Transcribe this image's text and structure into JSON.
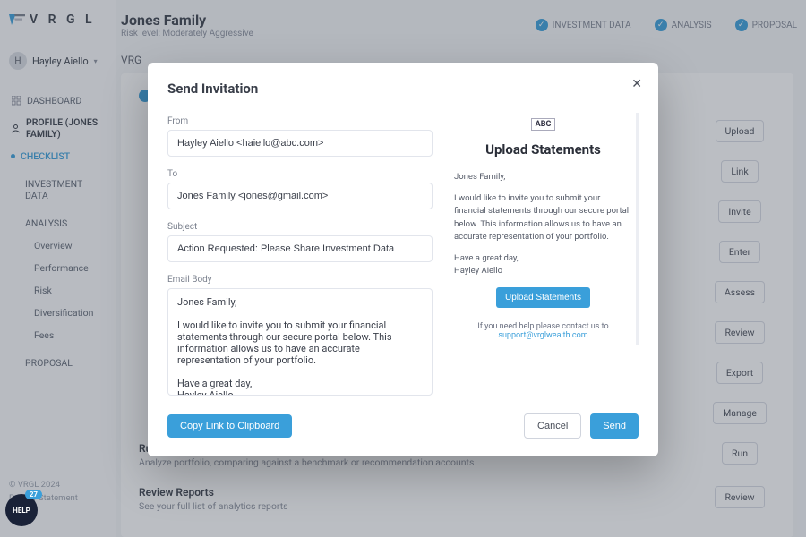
{
  "brand": "V R G L",
  "user": {
    "initial": "H",
    "name": "Hayley Aiello"
  },
  "sidebar": {
    "items": [
      {
        "label": "DASHBOARD",
        "icon": "grid"
      },
      {
        "label": "PROFILE (JONES FAMILY)",
        "icon": "person",
        "bold": true
      },
      {
        "label": "CHECKLIST",
        "active": true
      },
      {
        "label": "INVESTMENT DATA"
      },
      {
        "label": "ANALYSIS"
      }
    ],
    "analysis_children": [
      "Overview",
      "Performance",
      "Risk",
      "Diversification",
      "Fees"
    ],
    "items_tail": [
      {
        "label": "PROPOSAL"
      }
    ],
    "footer": {
      "copyright": "© VRGL 2024",
      "privacy": "Privacy Statement"
    }
  },
  "header": {
    "client": "Jones Family",
    "risk": "Risk level: Moderately Aggressive",
    "steps": [
      "INVESTMENT DATA",
      "ANALYSIS",
      "PROPOSAL"
    ]
  },
  "background": {
    "breadcrumb_stub": "VRG",
    "rows": [
      {
        "title_stub": "",
        "button": "Upload"
      },
      {
        "title_stub": "",
        "button": "Link"
      },
      {
        "title_stub": "",
        "button": "Invite"
      },
      {
        "title_stub": "",
        "button": "Enter"
      },
      {
        "title_stub": "",
        "button": "Assess"
      },
      {
        "title_stub": "",
        "button": "Review"
      },
      {
        "title_stub": "",
        "button": "Export"
      },
      {
        "title_stub": "",
        "button": "Manage"
      },
      {
        "title": "Run Analytics",
        "sub": "Analyze portfolio, comparing against a benchmark or recommendation accounts",
        "button": "Run"
      },
      {
        "title": "Review Reports",
        "sub": "See your full list of analytics reports",
        "button": "Review"
      }
    ]
  },
  "modal": {
    "title": "Send Invitation",
    "labels": {
      "from": "From",
      "to": "To",
      "subject": "Subject",
      "body": "Email Body"
    },
    "from": "Hayley Aiello <haiello@abc.com>",
    "to": "Jones Family <jones@gmail.com>",
    "subject": "Action Requested: Please Share Investment Data",
    "body": "Jones Family,\n\nI would like to invite you to submit your financial statements through our secure portal below. This information allows us to have an accurate representation of your portfolio.\n\nHave a great day,\nHayley Aiello",
    "preview": {
      "brand": "ABC",
      "headline": "Upload Statements",
      "greeting": "Jones Family,",
      "body": "I would like to invite you to submit your financial statements through our secure portal below. This information allows us to have an accurate representation of your portfolio.",
      "signoff": "Have a great day,\nHayley Aiello",
      "cta": "Upload Statements",
      "support_text": "If you need help please contact us to ",
      "support_email": "support@vrglwealth.com"
    },
    "buttons": {
      "copy": "Copy Link to Clipboard",
      "cancel": "Cancel",
      "send": "Send"
    }
  },
  "help": {
    "label": "HELP",
    "count": "27"
  }
}
